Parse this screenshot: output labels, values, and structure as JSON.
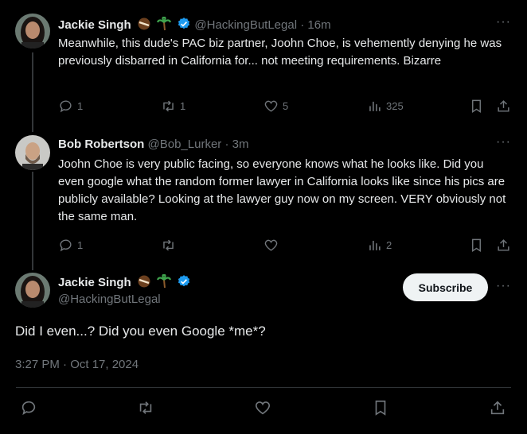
{
  "tweets": [
    {
      "name": "Jackie Singh",
      "handle": "@HackingButLegal",
      "time": "16m",
      "text": "Meanwhile, this dude's PAC biz partner, Joohn Choe, is vehemently denying he was previously disbarred in California for... not meeting requirements. Bizarre",
      "replies": "1",
      "retweets": "1",
      "likes": "5",
      "views": "325"
    },
    {
      "name": "Bob Robertson",
      "handle": "@Bob_Lurker",
      "time": "3m",
      "text": "Joohn Choe is very public facing, so everyone knows what he looks like.  Did you even google what the random former lawyer in California looks like since his pics are publicly available?  Looking at the lawyer guy now on my screen. VERY obviously not the same man.",
      "replies": "1",
      "retweets": "",
      "likes": "",
      "views": "2"
    }
  ],
  "main": {
    "name": "Jackie Singh",
    "handle": "@HackingButLegal",
    "subscribe_label": "Subscribe",
    "text": "Did I even...? Did you even Google *me*?",
    "timestamp": "3:27 PM · Oct 17, 2024"
  },
  "separator": " · ",
  "more_glyph": "···",
  "colors": {
    "background": "#000000",
    "text": "#e7e9ea",
    "muted": "#71767b",
    "verified": "#1d9bf0"
  },
  "icons": [
    "reply-icon",
    "retweet-icon",
    "like-icon",
    "views-icon",
    "bookmark-icon",
    "share-icon",
    "verified-icon",
    "coconut-emoji",
    "palm-tree-emoji",
    "more-icon"
  ]
}
